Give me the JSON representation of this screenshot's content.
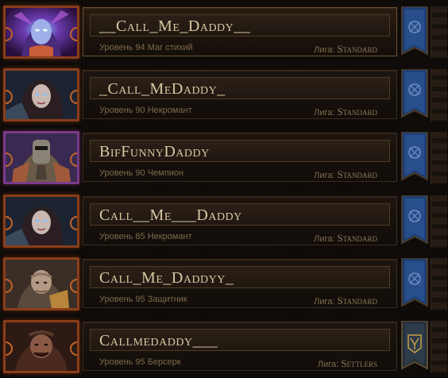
{
  "characters": [
    {
      "name": "__Call_Me_Daddy__",
      "level_class": "Уровень 94 Маг стихий",
      "league_label": "Лига:",
      "league": "Standard",
      "portrait_icon": "elementalist-portrait-icon",
      "banner_icon": "standard-league-banner-icon",
      "selected": true
    },
    {
      "name": "_Call_MeDaddy_",
      "level_class": "Уровень 90 Некромант",
      "league_label": "Лига:",
      "league": "Standard",
      "portrait_icon": "necromancer-portrait-icon",
      "banner_icon": "standard-league-banner-icon",
      "selected": false
    },
    {
      "name": "BifFunnyDaddy",
      "level_class": "Уровень 90 Чемпион",
      "league_label": "Лига:",
      "league": "Standard",
      "portrait_icon": "champion-portrait-icon",
      "banner_icon": "standard-league-banner-icon",
      "selected": false
    },
    {
      "name": "Call__Me___Daddy",
      "level_class": "Уровень 85 Некромант",
      "league_label": "Лига:",
      "league": "Standard",
      "portrait_icon": "necromancer-portrait-icon",
      "banner_icon": "standard-league-banner-icon",
      "selected": false
    },
    {
      "name": "Call_Me_Daddyy_",
      "level_class": "Уровень 95 Защитник",
      "league_label": "Лига:",
      "league": "Standard",
      "portrait_icon": "guardian-portrait-icon",
      "banner_icon": "standard-league-banner-icon",
      "selected": false
    },
    {
      "name": "Callmedaddy___",
      "level_class": "Уровень 95 Берсерк",
      "league_label": "Лига:",
      "league": "Settlers",
      "portrait_icon": "berserker-portrait-icon",
      "banner_icon": "settlers-league-banner-icon",
      "selected": false
    }
  ],
  "colors": {
    "name_text": "#d8c8a4",
    "detail_text": "#7d6b4c",
    "portrait_frame": "#8a3e19",
    "standard_banner": "#1f3f73",
    "settlers_banner": "#25303d"
  }
}
